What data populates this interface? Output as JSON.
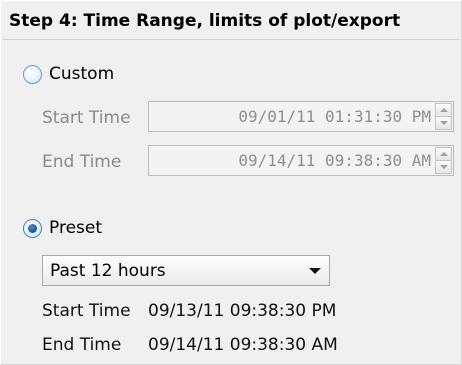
{
  "step": {
    "title": "Step 4: Time Range, limits of plot/export"
  },
  "custom": {
    "label": "Custom",
    "selected": false,
    "start_label": "Start Time",
    "start_value": "09/01/11 01:31:30 PM",
    "end_label": "End Time",
    "end_value": "09/14/11 09:38:30 AM"
  },
  "preset": {
    "label": "Preset",
    "selected": true,
    "dropdown_value": "Past 12 hours",
    "start_label": "Start Time",
    "start_value": "09/13/11 09:38:30 PM",
    "end_label": "End Time",
    "end_value": "09/14/11 09:38:30 AM"
  },
  "icons": {
    "spin_up": "chevron-up-icon",
    "spin_down": "chevron-down-icon",
    "dropdown": "caret-down-icon"
  },
  "colors": {
    "panel_bg": "#f0f0f0",
    "disabled_text": "#8a8a8a",
    "radio_dot": "#1b4f8a"
  }
}
